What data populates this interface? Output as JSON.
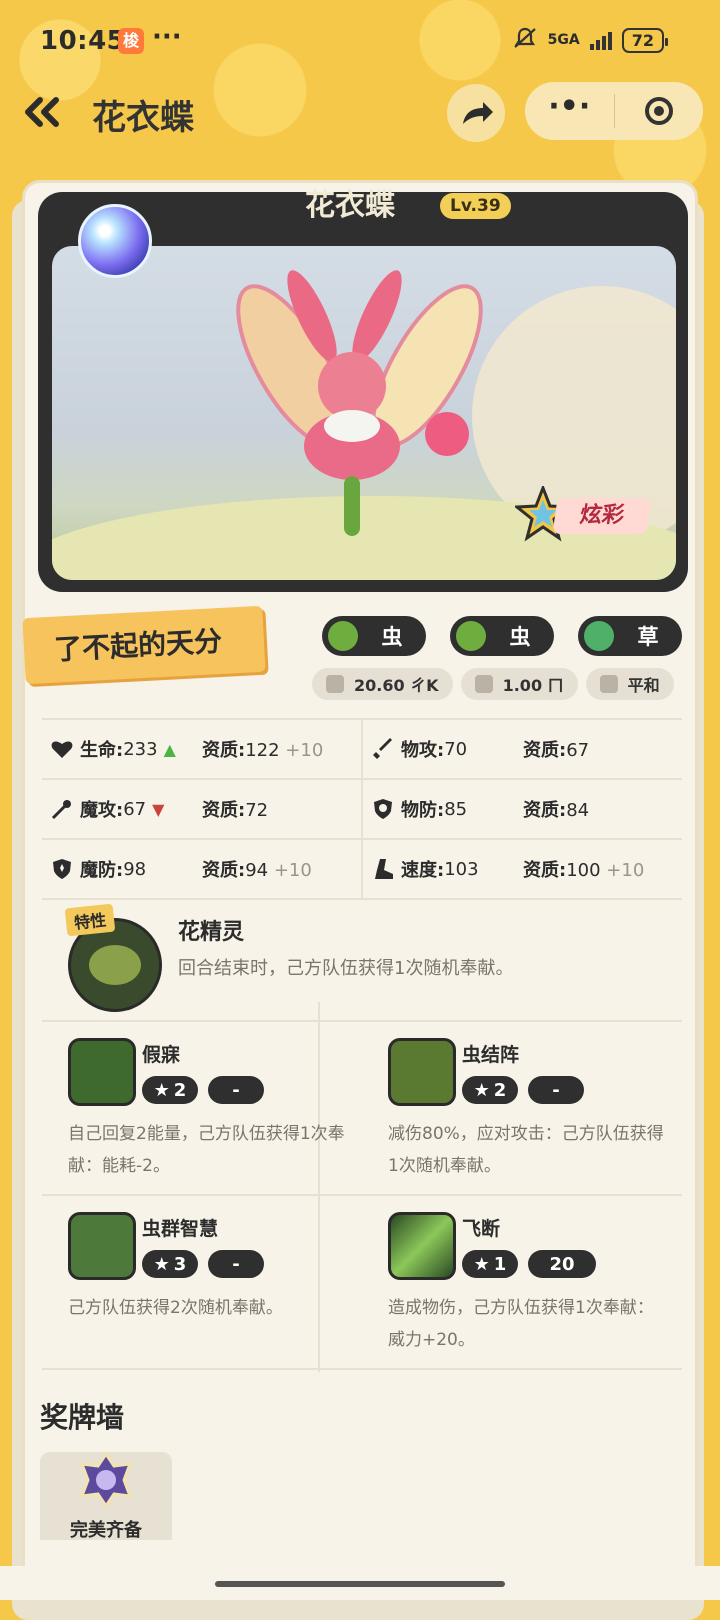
{
  "status_bar": {
    "time": "10:45",
    "app_badge": "梭",
    "dots": "···",
    "network": "5GA",
    "battery": "72"
  },
  "nav": {
    "back_label": "‹‹",
    "title": "花衣蝶",
    "more_label": "·•·"
  },
  "pet": {
    "name": "花衣蝶",
    "level": "Lv.39",
    "shiny_label": "炫彩"
  },
  "talent": "了不起的天分",
  "types": [
    {
      "label": "虫",
      "color": "#6fae3e"
    },
    {
      "label": "虫",
      "color": "#6fae3e"
    },
    {
      "label": "草",
      "color": "#4fb06a"
    }
  ],
  "info": {
    "weight": "20.60 ㄔK",
    "height": "1.00 ㄇ",
    "nature": "平和"
  },
  "stats": {
    "rows": [
      [
        {
          "name": "生命:",
          "value": "233",
          "apt_label": "资质:",
          "apt": "122",
          "bonus": "+10",
          "trend": "up"
        },
        {
          "name": "物攻:",
          "value": "70",
          "apt_label": "资质:",
          "apt": "67",
          "bonus": "",
          "trend": ""
        }
      ],
      [
        {
          "name": "魔攻:",
          "value": "67",
          "apt_label": "资质:",
          "apt": "72",
          "bonus": "",
          "trend": "down"
        },
        {
          "name": "物防:",
          "value": "85",
          "apt_label": "资质:",
          "apt": "84",
          "bonus": "",
          "trend": ""
        }
      ],
      [
        {
          "name": "魔防:",
          "value": "98",
          "apt_label": "资质:",
          "apt": "94",
          "bonus": "+10",
          "trend": ""
        },
        {
          "name": "速度:",
          "value": "103",
          "apt_label": "资质:",
          "apt": "100",
          "bonus": "+10",
          "trend": ""
        }
      ]
    ]
  },
  "trait": {
    "tag": "特性",
    "name": "花精灵",
    "desc": "回合结束时，己方队伍获得1次随机奉献。"
  },
  "skills": [
    {
      "name": "假寐",
      "cost": "2",
      "power": "-",
      "desc": "自己回复2能量，己方队伍获得1次奉献：能耗-2。"
    },
    {
      "name": "虫结阵",
      "cost": "2",
      "power": "-",
      "desc": "减伤80%，应对攻击：己方队伍获得1次随机奉献。"
    },
    {
      "name": "虫群智慧",
      "cost": "3",
      "power": "-",
      "desc": "己方队伍获得2次随机奉献。"
    },
    {
      "name": "飞断",
      "cost": "1",
      "power": "20",
      "desc": "造成物伤，己方队伍获得1次奉献：威力+20。"
    }
  ],
  "medals": {
    "title": "奖牌墙",
    "items": [
      {
        "label": "完美齐备"
      }
    ]
  }
}
